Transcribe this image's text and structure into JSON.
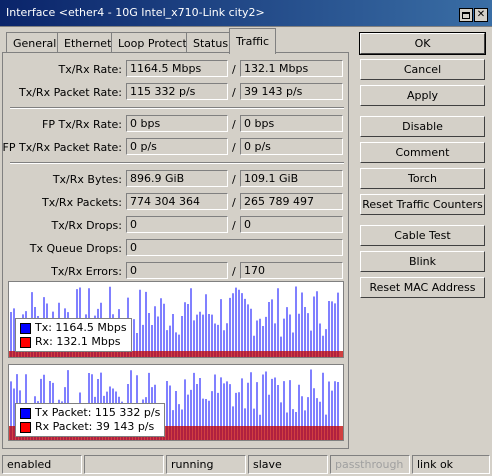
{
  "window": {
    "title": "Interface <ether4 - 10G Intel_x710-Link city2>"
  },
  "tabs": [
    {
      "label": "General"
    },
    {
      "label": "Ethernet"
    },
    {
      "label": "Loop Protect"
    },
    {
      "label": "Status"
    },
    {
      "label": "Traffic"
    }
  ],
  "fields": {
    "tx_rx_rate": {
      "label": "Tx/Rx Rate:",
      "tx": "1164.5 Mbps",
      "rx": "132.1 Mbps"
    },
    "tx_rx_packet_rate": {
      "label": "Tx/Rx Packet Rate:",
      "tx": "115 332 p/s",
      "rx": "39 143 p/s"
    },
    "fp_tx_rx_rate": {
      "label": "FP Tx/Rx Rate:",
      "tx": "0 bps",
      "rx": "0 bps"
    },
    "fp_tx_rx_packet_rate": {
      "label": "FP Tx/Rx Packet Rate:",
      "tx": "0 p/s",
      "rx": "0 p/s"
    },
    "tx_rx_bytes": {
      "label": "Tx/Rx Bytes:",
      "tx": "896.9 GiB",
      "rx": "109.1 GiB"
    },
    "tx_rx_packets": {
      "label": "Tx/Rx Packets:",
      "tx": "774 304 364",
      "rx": "265 789 497"
    },
    "tx_rx_drops": {
      "label": "Tx/Rx Drops:",
      "tx": "0",
      "rx": "0"
    },
    "tx_queue_drops": {
      "label": "Tx Queue Drops:",
      "value": "0"
    },
    "tx_rx_errors": {
      "label": "Tx/Rx Errors:",
      "tx": "0",
      "rx": "170"
    }
  },
  "slash": "/",
  "buttons": {
    "ok": "OK",
    "cancel": "Cancel",
    "apply": "Apply",
    "disable": "Disable",
    "comment": "Comment",
    "torch": "Torch",
    "reset_traffic_counters": "Reset Traffic Counters",
    "cable_test": "Cable Test",
    "blink": "Blink",
    "reset_mac_address": "Reset MAC Address"
  },
  "graph_bits": {
    "legend": {
      "tx": "Tx:  1164.5 Mbps",
      "rx": "Rx:  132.1 Mbps"
    }
  },
  "graph_packets": {
    "legend": {
      "tx": "Tx Packet:  115 332 p/s",
      "rx": "Rx Packet:  39 143 p/s"
    }
  },
  "colors": {
    "tx": "#0000ff",
    "rx": "#c00000"
  },
  "statusbar": [
    "enabled",
    "",
    "running",
    "slave",
    "passthrough",
    "link ok"
  ]
}
